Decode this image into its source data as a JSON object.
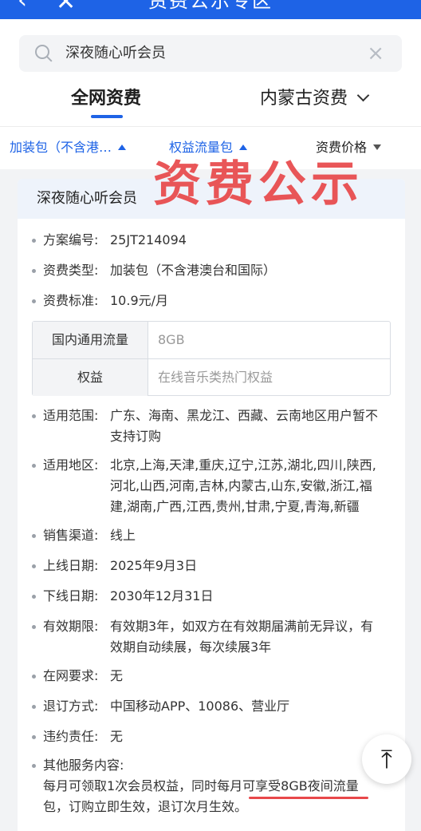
{
  "topbar": {
    "title": "资费公示专区",
    "back_icon": "‹",
    "close_icon": "✕"
  },
  "search": {
    "value": "深夜随心听会员",
    "clear_icon": "×"
  },
  "tabs": [
    {
      "label": "全网资费"
    },
    {
      "label": "内蒙古资费"
    }
  ],
  "filters": [
    {
      "label": "加装包（不含港…"
    },
    {
      "label": "权益流量包"
    },
    {
      "label": "资费价格"
    }
  ],
  "card": {
    "title": "深夜随心听会员",
    "stamp": "资费公示",
    "details": [
      {
        "label": "方案编号:",
        "value": "25JT214094"
      },
      {
        "label": "资费类型:",
        "value": "加装包（不含港澳台和国际）"
      },
      {
        "label": "资费标准:",
        "value": "10.9元/月"
      }
    ],
    "spec": [
      {
        "label": "国内通用流量",
        "value": "8GB"
      },
      {
        "label": "权益",
        "value": "在线音乐类热门权益"
      }
    ],
    "details2": [
      {
        "label": "适用范围:",
        "value": "广东、海南、黑龙江、西藏、云南地区用户暂不支持订购"
      },
      {
        "label": "适用地区:",
        "value": "北京,上海,天津,重庆,辽宁,江苏,湖北,四川,陕西,河北,山西,河南,吉林,内蒙古,山东,安徽,浙江,福建,湖南,广西,江西,贵州,甘肃,宁夏,青海,新疆"
      },
      {
        "label": "销售渠道:",
        "value": "线上"
      },
      {
        "label": "上线日期:",
        "value": "2025年9月3日"
      },
      {
        "label": "下线日期:",
        "value": "2030年12月31日"
      },
      {
        "label": "有效期限:",
        "value": "有效期3年，如双方在有效期届满前无异议，有效期自动续展，每次续展3年"
      },
      {
        "label": "在网要求:",
        "value": "无"
      },
      {
        "label": "退订方式:",
        "value": "中国移动APP、10086、营业厅"
      },
      {
        "label": "违约责任:",
        "value": "无"
      }
    ],
    "other_label": "其他服务内容:",
    "other_text": "每月可领取1次会员权益，同时每月可享受8GB夜间流量包，订购立即生效，退订次月生效。"
  },
  "to_top_icon": "⤒",
  "colors": {
    "accent": "#1e63e6",
    "stamp": "#e8484a"
  }
}
